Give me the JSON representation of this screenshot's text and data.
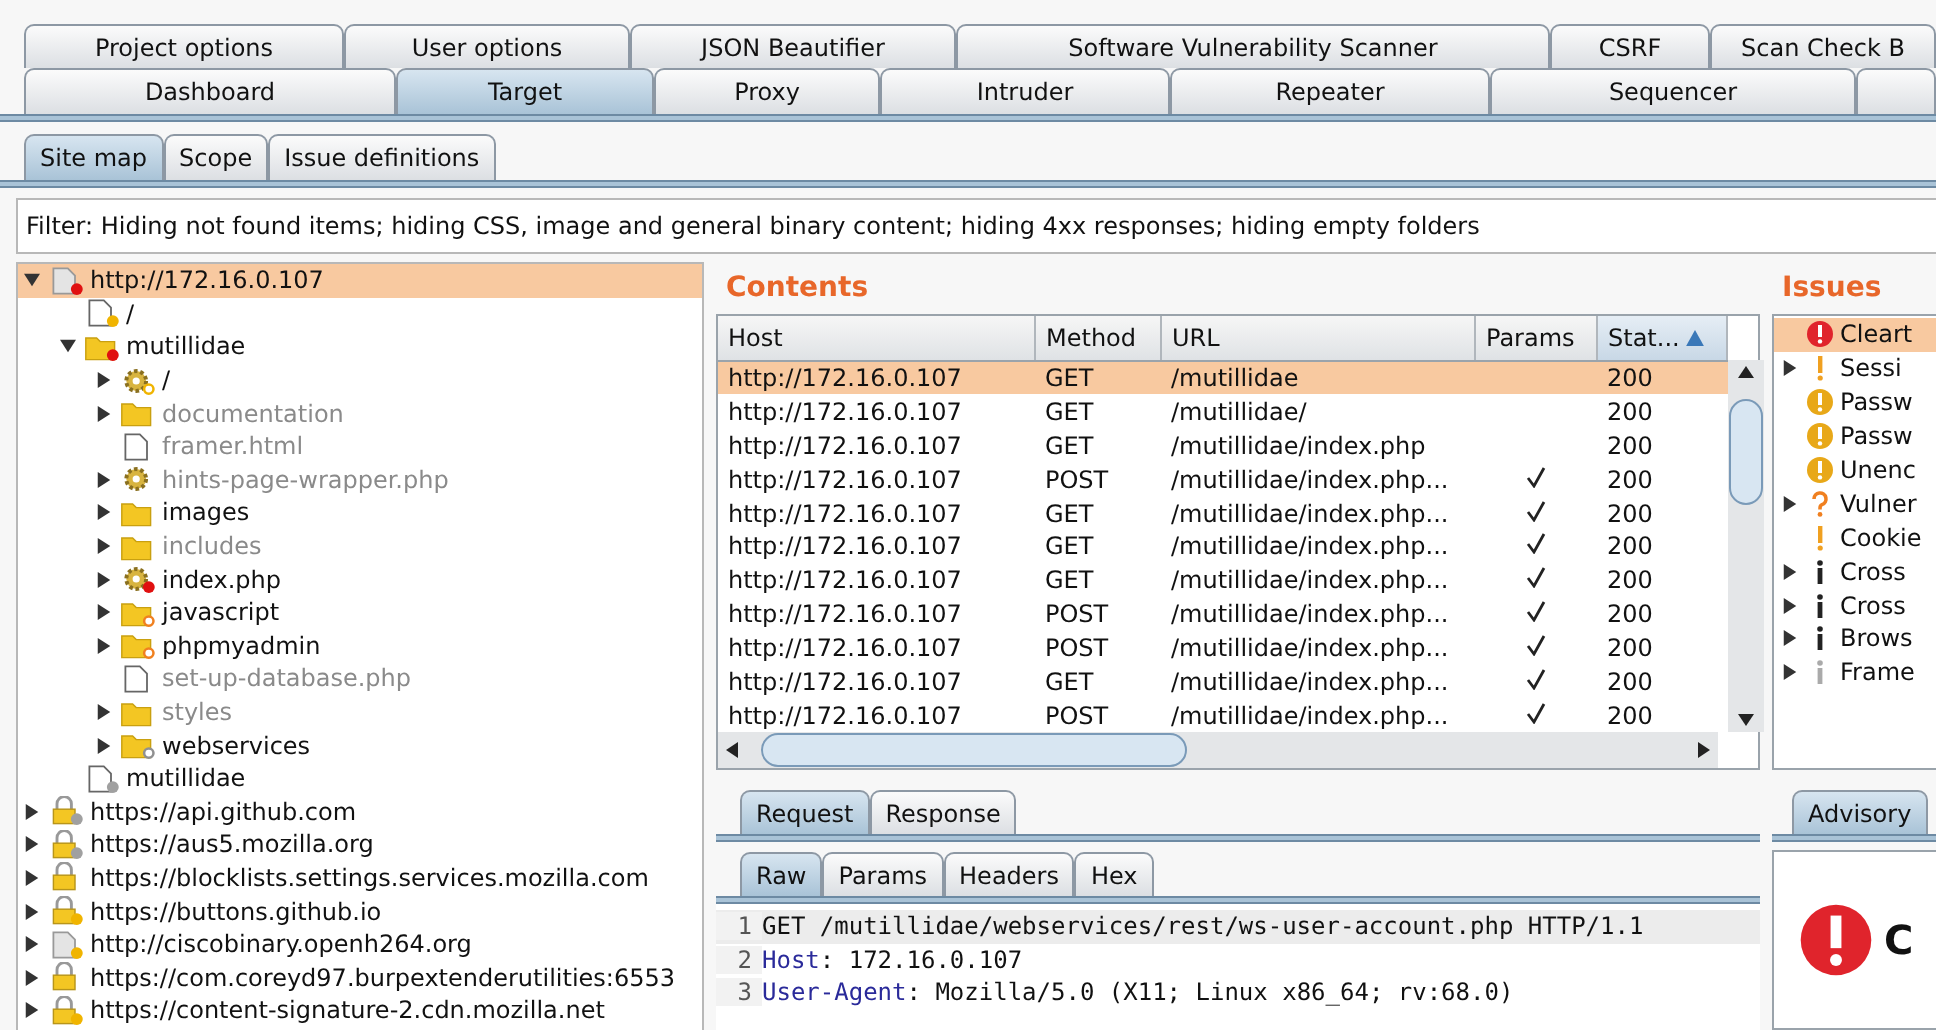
{
  "top_tabs": [
    {
      "label": "Project options",
      "selected": false
    },
    {
      "label": "User options",
      "selected": false
    },
    {
      "label": "JSON Beautifier",
      "selected": false
    },
    {
      "label": "Software Vulnerability Scanner",
      "selected": false
    },
    {
      "label": "CSRF",
      "selected": false
    },
    {
      "label": "Scan Check B",
      "selected": false
    }
  ],
  "main_tabs": [
    {
      "label": "Dashboard",
      "selected": false
    },
    {
      "label": "Target",
      "selected": true
    },
    {
      "label": "Proxy",
      "selected": false
    },
    {
      "label": "Intruder",
      "selected": false
    },
    {
      "label": "Repeater",
      "selected": false
    },
    {
      "label": "Sequencer",
      "selected": false
    },
    {
      "selected": false
    }
  ],
  "sub_tabs": [
    {
      "label": "Site map",
      "selected": true
    },
    {
      "label": "Scope",
      "selected": false
    },
    {
      "label": "Issue definitions",
      "selected": false
    }
  ],
  "filter": "Filter: Hiding not found items;  hiding CSS, image and general binary content;  hiding 4xx responses;  hiding empty folders",
  "site_map": [
    {
      "label": "http://172.16.0.107",
      "kind": "host",
      "marker": {
        "kind": "filled",
        "color": "#e01010"
      },
      "greyed": false,
      "selected": true,
      "expandable": true,
      "expanded": true,
      "children": [
        {
          "label": "/",
          "kind": "file",
          "marker": {
            "kind": "filled",
            "color": "#f0b400"
          },
          "greyed": false,
          "selected": false,
          "expandable": false,
          "expanded": false
        },
        {
          "label": "mutillidae",
          "kind": "folder",
          "marker": {
            "kind": "filled",
            "color": "#e01010"
          },
          "greyed": false,
          "selected": false,
          "expandable": true,
          "expanded": true,
          "children": [
            {
              "label": "/",
              "kind": "gear",
              "marker": {
                "kind": "ring",
                "color": "#f0b400"
              },
              "greyed": false,
              "selected": false,
              "expandable": true,
              "expanded": false
            },
            {
              "label": "documentation",
              "kind": "folder",
              "greyed": true,
              "selected": false,
              "expandable": true,
              "expanded": false
            },
            {
              "label": "framer.html",
              "kind": "file",
              "greyed": true,
              "selected": false,
              "expandable": false,
              "expanded": false
            },
            {
              "label": "hints-page-wrapper.php",
              "kind": "gear",
              "greyed": true,
              "selected": false,
              "expandable": true,
              "expanded": false
            },
            {
              "label": "images",
              "kind": "folder",
              "greyed": false,
              "selected": false,
              "expandable": true,
              "expanded": false
            },
            {
              "label": "includes",
              "kind": "folder",
              "greyed": true,
              "selected": false,
              "expandable": true,
              "expanded": false
            },
            {
              "label": "index.php",
              "kind": "gear",
              "marker": {
                "kind": "filled",
                "color": "#e01010"
              },
              "greyed": false,
              "selected": false,
              "expandable": true,
              "expanded": false
            },
            {
              "label": "javascript",
              "kind": "folder",
              "marker": {
                "kind": "ring",
                "color": "#f08020"
              },
              "greyed": false,
              "selected": false,
              "expandable": true,
              "expanded": false
            },
            {
              "label": "phpmyadmin",
              "kind": "folder",
              "marker": {
                "kind": "ring",
                "color": "#f08020"
              },
              "greyed": false,
              "selected": false,
              "expandable": true,
              "expanded": false
            },
            {
              "label": "set-up-database.php",
              "kind": "file",
              "greyed": true,
              "selected": false,
              "expandable": false,
              "expanded": false
            },
            {
              "label": "styles",
              "kind": "folder",
              "greyed": true,
              "selected": false,
              "expandable": true,
              "expanded": false
            },
            {
              "label": "webservices",
              "kind": "folder",
              "marker": {
                "kind": "ring",
                "color": "#909090"
              },
              "greyed": false,
              "selected": false,
              "expandable": true,
              "expanded": false
            }
          ]
        },
        {
          "label": "mutillidae",
          "kind": "file",
          "marker": {
            "kind": "filled",
            "color": "#a0a0a0"
          },
          "greyed": false,
          "selected": false,
          "expandable": false,
          "expanded": false
        }
      ]
    },
    {
      "label": "https://api.github.com",
      "kind": "lock",
      "marker": {
        "kind": "filled",
        "color": "#a0a0a0"
      },
      "greyed": false,
      "selected": false,
      "expandable": true,
      "expanded": false
    },
    {
      "label": "https://aus5.mozilla.org",
      "kind": "lock",
      "marker": {
        "kind": "filled",
        "color": "#a0a0a0"
      },
      "greyed": false,
      "selected": false,
      "expandable": true,
      "expanded": false
    },
    {
      "label": "https://blocklists.settings.services.mozilla.com",
      "kind": "lock",
      "greyed": false,
      "selected": false,
      "expandable": true,
      "expanded": false
    },
    {
      "label": "https://buttons.github.io",
      "kind": "lock",
      "marker": {
        "kind": "filled",
        "color": "#f0b400"
      },
      "greyed": false,
      "selected": false,
      "expandable": true,
      "expanded": false
    },
    {
      "label": "http://ciscobinary.openh264.org",
      "kind": "host",
      "marker": {
        "kind": "filled",
        "color": "#f0b400"
      },
      "greyed": false,
      "selected": false,
      "expandable": true,
      "expanded": false
    },
    {
      "label": "https://com.coreyd97.burpextenderutilities:6553",
      "kind": "lock",
      "greyed": false,
      "selected": false,
      "expandable": true,
      "expanded": false
    },
    {
      "label": "https://content-signature-2.cdn.mozilla.net",
      "kind": "lock",
      "marker": {
        "kind": "filled",
        "color": "#f0b400"
      },
      "greyed": false,
      "selected": false,
      "expandable": true,
      "expanded": false
    }
  ],
  "contents": {
    "title": "Contents",
    "columns": [
      {
        "label": "Host",
        "sorted": false
      },
      {
        "label": "Method",
        "sorted": false
      },
      {
        "label": "URL",
        "sorted": false
      },
      {
        "label": "Params",
        "sorted": false
      },
      {
        "label": "Stat...",
        "sorted": true
      }
    ],
    "rows": [
      {
        "host": "http://172.16.0.107",
        "method": "GET",
        "url": "/mutillidae",
        "params": false,
        "status": "200",
        "selected": true
      },
      {
        "host": "http://172.16.0.107",
        "method": "GET",
        "url": "/mutillidae/",
        "params": false,
        "status": "200",
        "selected": false
      },
      {
        "host": "http://172.16.0.107",
        "method": "GET",
        "url": "/mutillidae/index.php",
        "params": false,
        "status": "200",
        "selected": false
      },
      {
        "host": "http://172.16.0.107",
        "method": "POST",
        "url": "/mutillidae/index.php...",
        "params": true,
        "status": "200",
        "selected": false
      },
      {
        "host": "http://172.16.0.107",
        "method": "GET",
        "url": "/mutillidae/index.php...",
        "params": true,
        "status": "200",
        "selected": false
      },
      {
        "host": "http://172.16.0.107",
        "method": "GET",
        "url": "/mutillidae/index.php...",
        "params": true,
        "status": "200",
        "selected": false
      },
      {
        "host": "http://172.16.0.107",
        "method": "GET",
        "url": "/mutillidae/index.php...",
        "params": true,
        "status": "200",
        "selected": false
      },
      {
        "host": "http://172.16.0.107",
        "method": "POST",
        "url": "/mutillidae/index.php...",
        "params": true,
        "status": "200",
        "selected": false
      },
      {
        "host": "http://172.16.0.107",
        "method": "POST",
        "url": "/mutillidae/index.php...",
        "params": true,
        "status": "200",
        "selected": false
      },
      {
        "host": "http://172.16.0.107",
        "method": "GET",
        "url": "/mutillidae/index.php...",
        "params": true,
        "status": "200",
        "selected": false
      },
      {
        "host": "http://172.16.0.107",
        "method": "POST",
        "url": "/mutillidae/index.php...",
        "params": true,
        "status": "200",
        "selected": false
      }
    ]
  },
  "message_tabs": [
    {
      "label": "Request",
      "selected": true
    },
    {
      "label": "Response",
      "selected": false
    }
  ],
  "view_tabs": [
    {
      "label": "Raw",
      "selected": true
    },
    {
      "label": "Params",
      "selected": false
    },
    {
      "label": "Headers",
      "selected": false
    },
    {
      "label": "Hex",
      "selected": false
    }
  ],
  "request_lines": [
    {
      "number": "1",
      "kind": "request-line",
      "text": "GET /mutillidae/webservices/rest/ws-user-account.php HTTP/1.1",
      "highlighted": true
    },
    {
      "number": "2",
      "kind": "header",
      "name": "Host",
      "value": ": 172.16.0.107",
      "highlighted": false
    },
    {
      "number": "3",
      "kind": "header",
      "name": "User-Agent",
      "value": ": Mozilla/5.0 (X11; Linux x86_64; rv:68.0)",
      "highlighted": false
    }
  ],
  "issues": {
    "title": "Issues",
    "items": [
      {
        "label": "Cleart",
        "kind": "high",
        "expandable": false,
        "selected": true
      },
      {
        "label": "Sessi",
        "kind": "medium",
        "expandable": true,
        "selected": false
      },
      {
        "label": "Passw",
        "kind": "low",
        "expandable": false,
        "selected": false
      },
      {
        "label": "Passw",
        "kind": "low",
        "expandable": false,
        "selected": false
      },
      {
        "label": "Unenc",
        "kind": "low",
        "expandable": false,
        "selected": false
      },
      {
        "label": "Vulner",
        "kind": "tentative",
        "expandable": true,
        "selected": false
      },
      {
        "label": "Cookie",
        "kind": "medium",
        "expandable": false,
        "selected": false
      },
      {
        "label": "Cross",
        "kind": "info",
        "expandable": true,
        "selected": false
      },
      {
        "label": "Cross",
        "kind": "info",
        "expandable": true,
        "selected": false
      },
      {
        "label": "Brows",
        "kind": "info",
        "expandable": true,
        "selected": false
      },
      {
        "label": "Frame",
        "kind": "faint",
        "expandable": true,
        "selected": false
      }
    ]
  },
  "advisory_tabs": [
    {
      "label": "Advisory",
      "selected": true
    }
  ],
  "advisory": {
    "title": "C",
    "kind": "high"
  }
}
